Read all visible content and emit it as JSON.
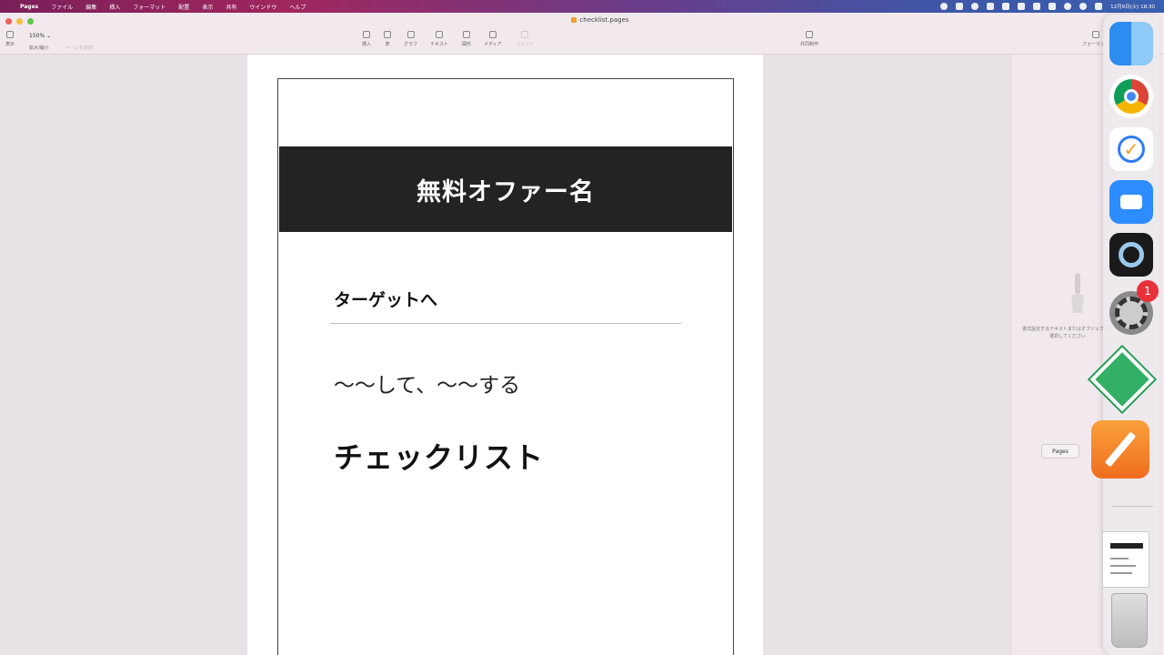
{
  "menubar": {
    "app_name": "Pages",
    "items": [
      "ファイル",
      "編集",
      "挿入",
      "フォーマット",
      "配置",
      "表示",
      "共有",
      "ウインドウ",
      "ヘルプ"
    ],
    "clock": "12月9日(火) 18:30"
  },
  "window": {
    "title": "checklist.pages"
  },
  "toolbar": {
    "view_label": "表示",
    "zoom_value": "150% ⌄",
    "zoom_label": "拡大/縮小",
    "page_thumb_label": "ページを追加",
    "insert_label": "挿入",
    "table_label": "表",
    "chart_label": "グラフ",
    "text_label": "テキスト",
    "shape_label": "図形",
    "media_label": "メディア",
    "comment_label": "コメント",
    "collab_label": "共同制作",
    "format_label": "フォーマット"
  },
  "document": {
    "banner_title": "無料オファー名",
    "target_heading": "ターゲットへ",
    "description": "〜〜して、〜〜する",
    "checklist_heading": "チェックリスト"
  },
  "right_panel": {
    "note": "書式設定するテキストまたはオブジェクトを選択してください"
  },
  "dock": {
    "tooltip": "Pages",
    "badge_count": "1"
  }
}
